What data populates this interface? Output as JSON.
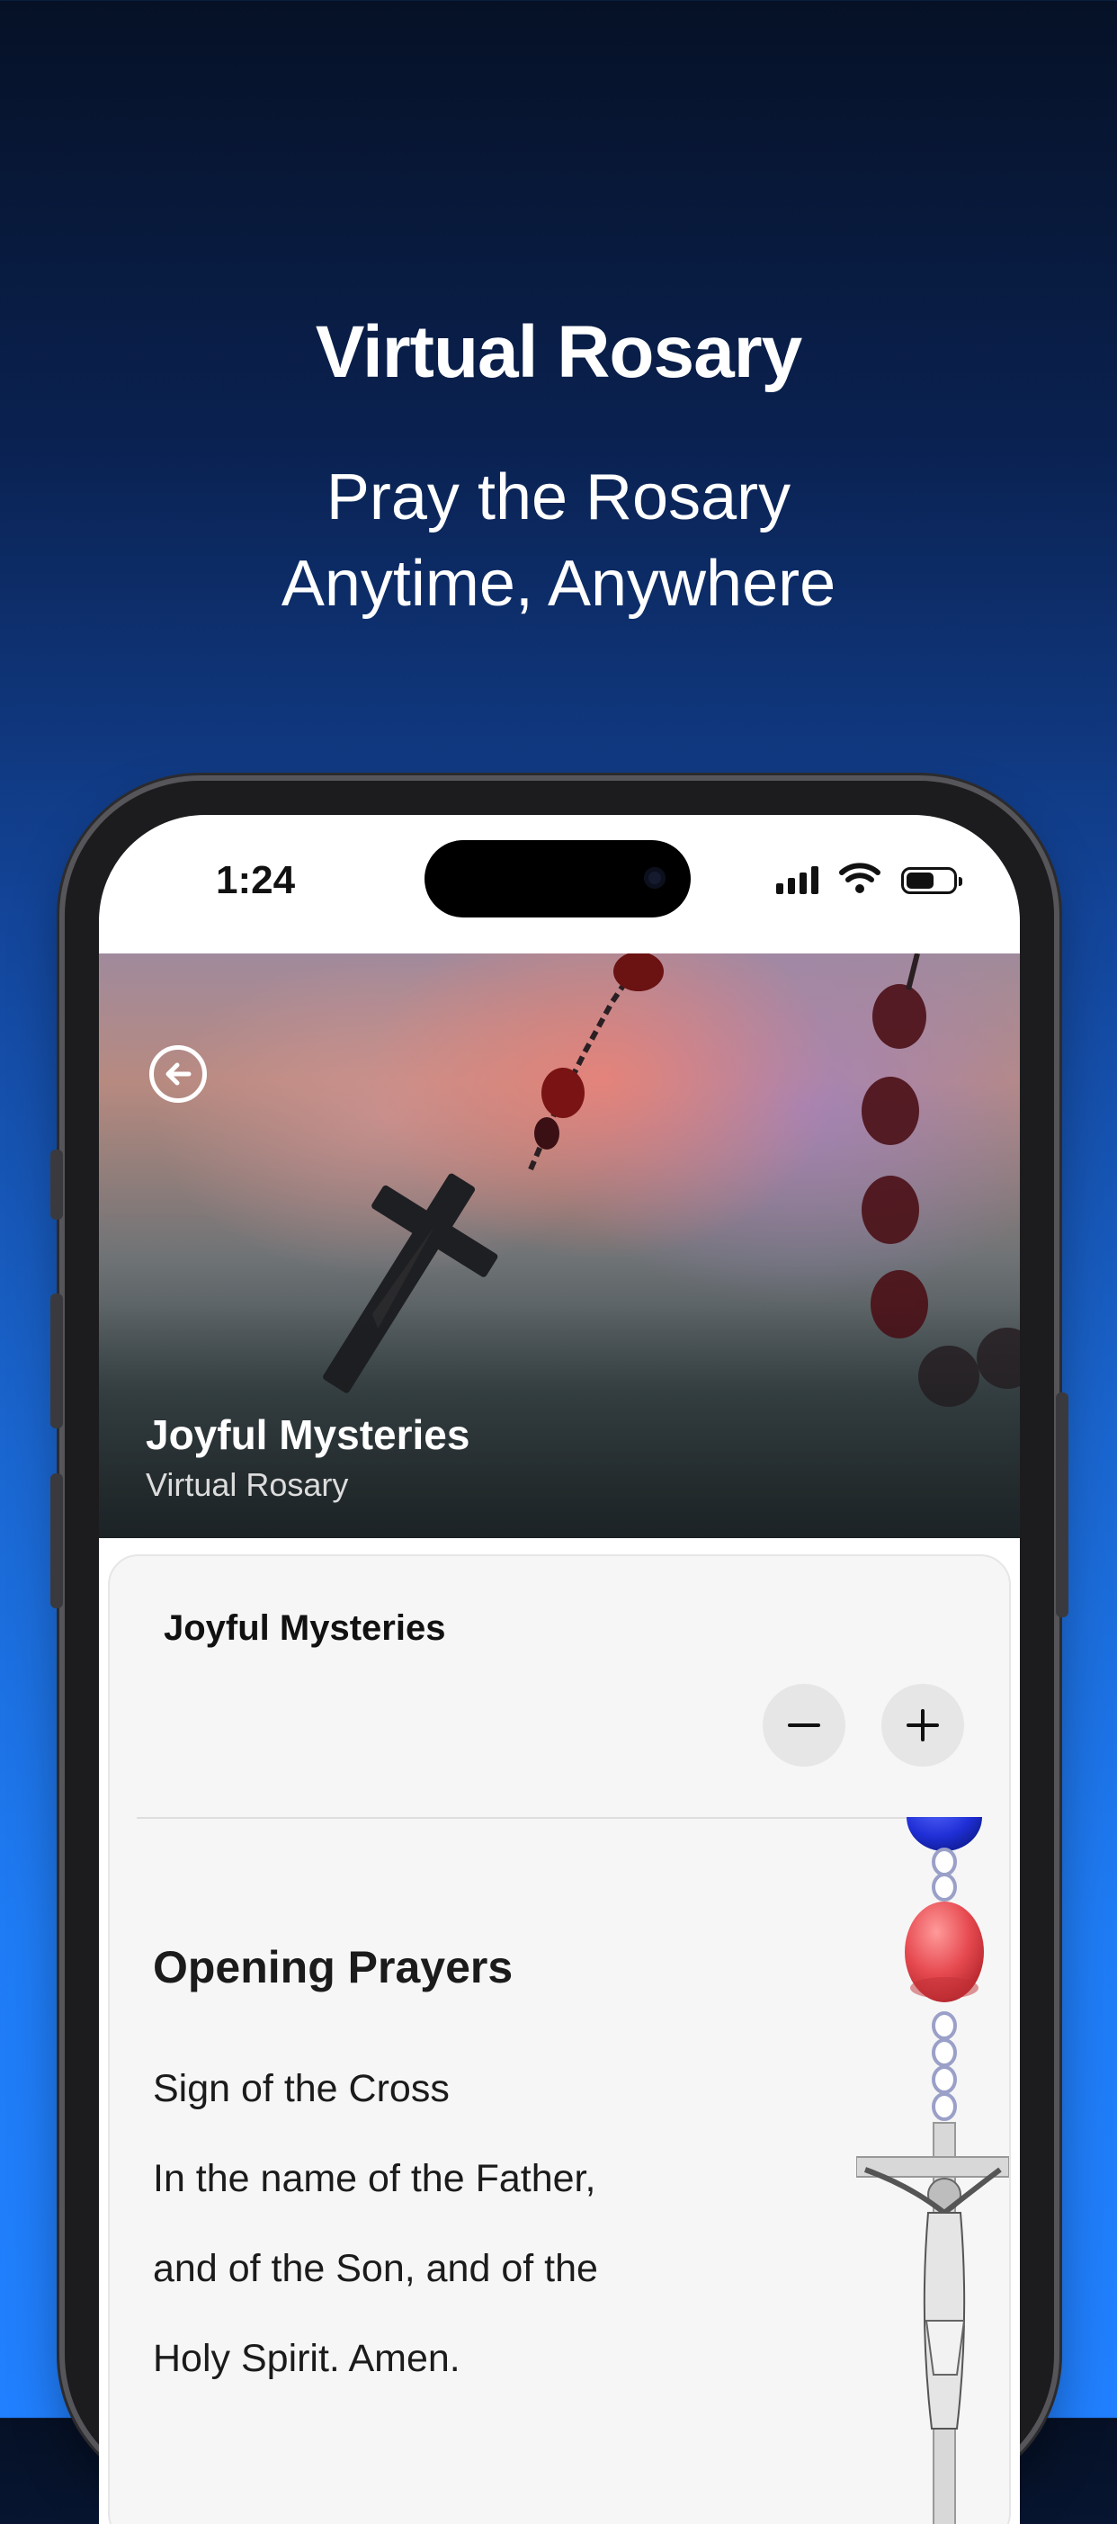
{
  "promo": {
    "title": "Virtual Rosary",
    "subtitle_line1": "Pray the Rosary",
    "subtitle_line2": "Anytime, Anywhere"
  },
  "status_bar": {
    "time": "1:24",
    "icons": [
      "signal-icon",
      "wifi-icon",
      "battery-icon"
    ]
  },
  "hero": {
    "title": "Joyful Mysteries",
    "subtitle": "Virtual Rosary",
    "back_icon": "back-arrow-circle-icon"
  },
  "card": {
    "title": "Joyful Mysteries",
    "decrease_icon": "minus-icon",
    "increase_icon": "plus-icon",
    "section_title": "Opening Prayers",
    "prayer_lines": [
      "Sign of the Cross",
      "In the name of the Father,",
      "and of the Son, and of the",
      "Holy Spirit. Amen."
    ]
  },
  "colors": {
    "bead_blue": "#1f2fd6",
    "bead_red": "#e64a50",
    "background_top": "#061126",
    "background_bottom": "#2180ff"
  }
}
